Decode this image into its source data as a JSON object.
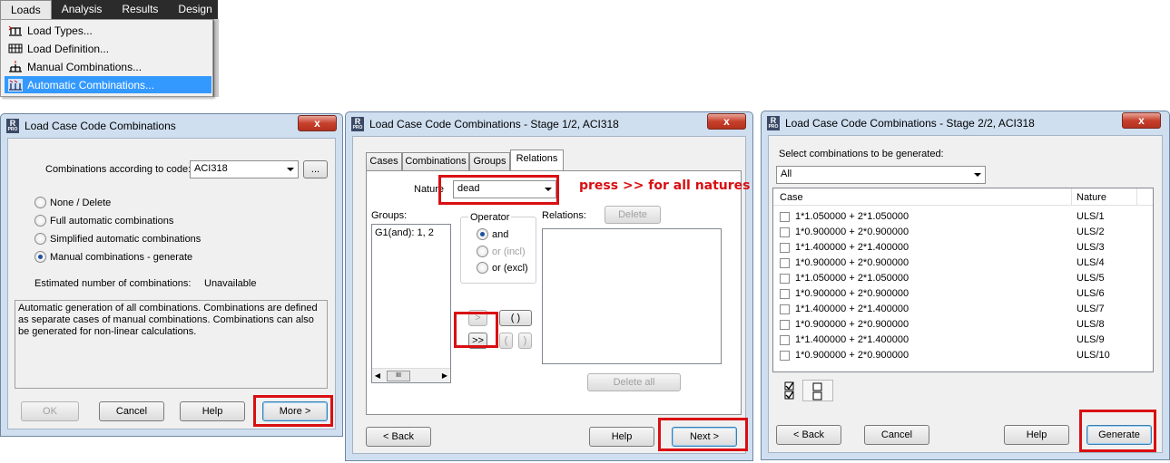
{
  "menu": {
    "bar": [
      "Loads",
      "Analysis",
      "Results",
      "Design"
    ],
    "items": [
      {
        "label": "Load Types...",
        "icon": "load-types-icon"
      },
      {
        "label": "Load Definition...",
        "icon": "load-definition-icon"
      },
      {
        "label": "Manual Combinations...",
        "icon": "manual-combinations-icon"
      },
      {
        "label": "Automatic Combinations...",
        "icon": "automatic-combinations-icon"
      }
    ]
  },
  "dialog1": {
    "title": "Load Case Code Combinations",
    "close": "x",
    "code_label": "Combinations according to code:",
    "code_value": "ACI318",
    "code_browse": "...",
    "options": [
      "None / Delete",
      "Full automatic combinations",
      "Simplified automatic combinations",
      "Manual combinations - generate"
    ],
    "selected_option": 3,
    "estimate_label": "Estimated number of combinations:",
    "estimate_value": "Unavailable",
    "description": "Automatic generation of all combinations. Combinations are defined as separate cases of manual combinations. Combinations can also be generated for non-linear calculations.",
    "buttons": {
      "ok": "OK",
      "cancel": "Cancel",
      "help": "Help",
      "more": "More >"
    }
  },
  "dialog2": {
    "title": "Load Case Code Combinations - Stage 1/2, ACI318",
    "close": "x",
    "tabs": [
      "Cases",
      "Combinations",
      "Groups",
      "Relations"
    ],
    "active_tab": 3,
    "nature_label": "Nature",
    "nature_value": "dead",
    "annotation": "press >> for all natures",
    "groups_label": "Groups:",
    "groups_items": [
      "G1(and): 1, 2"
    ],
    "scroll_glyph": "III",
    "operator_label": "Operator",
    "operators": [
      "and",
      "or (incl)",
      "or (excl)"
    ],
    "relations_label": "Relations:",
    "delete_label": "Delete",
    "delete_all_label": "Delete all",
    "arrow_single": ">",
    "arrow_all": ">>",
    "paren_pair": "( )",
    "paren_open": "(",
    "paren_close": ")",
    "buttons": {
      "back": "< Back",
      "help": "Help",
      "next": "Next >"
    }
  },
  "dialog3": {
    "title": "Load Case Code Combinations - Stage 2/2, ACI318",
    "close": "x",
    "select_label": "Select combinations to be generated:",
    "filter_value": "All",
    "col_case": "Case",
    "col_nature": "Nature",
    "rows": [
      {
        "case": "1*1.050000 + 2*1.050000",
        "nature": "ULS/1"
      },
      {
        "case": "1*0.900000 + 2*0.900000",
        "nature": "ULS/2"
      },
      {
        "case": "1*1.400000 + 2*1.400000",
        "nature": "ULS/3"
      },
      {
        "case": "1*0.900000 + 2*0.900000",
        "nature": "ULS/4"
      },
      {
        "case": "1*1.050000 + 2*1.050000",
        "nature": "ULS/5"
      },
      {
        "case": "1*0.900000 + 2*0.900000",
        "nature": "ULS/6"
      },
      {
        "case": "1*1.400000 + 2*1.400000",
        "nature": "ULS/7"
      },
      {
        "case": "1*0.900000 + 2*0.900000",
        "nature": "ULS/8"
      },
      {
        "case": "1*1.400000 + 2*1.400000",
        "nature": "ULS/9"
      },
      {
        "case": "1*0.900000 + 2*0.900000",
        "nature": "ULS/10"
      }
    ],
    "buttons": {
      "back": "< Back",
      "cancel": "Cancel",
      "help": "Help",
      "generate": "Generate"
    }
  }
}
